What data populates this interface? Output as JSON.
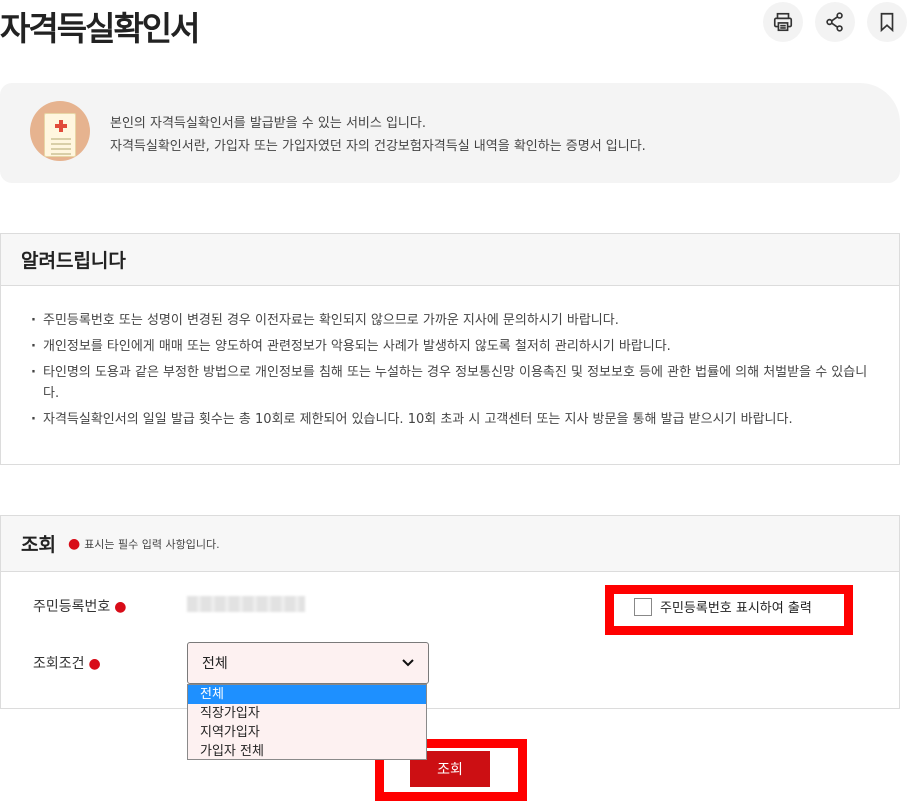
{
  "page": {
    "title": "자격득실확인서"
  },
  "toolbar": {
    "icons": [
      "print-icon",
      "share-icon",
      "bookmark-icon"
    ]
  },
  "intro": {
    "line1": "본인의 자격득실확인서를 발급받을 수 있는 서비스 입니다.",
    "line2": "자격득실확인서란, 가입자 또는 가입자였던 자의 건강보험자격득실 내역을 확인하는 증명서 입니다."
  },
  "notice": {
    "title": "알려드립니다",
    "items": [
      "주민등록번호 또는 성명이 변경된 경우 이전자료는 확인되지 않으므로 가까운 지사에 문의하시기 바랍니다.",
      "개인정보를 타인에게 매매 또는 양도하여 관련정보가 악용되는 사례가 발생하지 않도록 철저히 관리하시기 바랍니다.",
      "타인명의 도용과 같은 부정한 방법으로 개인정보를 침해 또는 누설하는 경우 정보통신망 이용촉진 및 정보보호 등에 관한 법률에 의해 처벌받을 수 있습니다.",
      "자격득실확인서의 일일 발급 횟수는 총 10회로 제한되어 있습니다. 10회 초과 시 고객센터 또는 지사 방문을 통해 발급 받으시기 바랍니다."
    ]
  },
  "query": {
    "title": "조회",
    "required_note": "표시는 필수 입력 사항입니다.",
    "rrn_label": "주민등록번호",
    "show_rrn_label": "주민등록번호 표시하여 출력",
    "condition_label": "조회조건",
    "condition_selected": "전체",
    "condition_options": [
      "전체",
      "직장가입자",
      "지역가입자",
      "가입자 전체"
    ],
    "submit_label": "조회"
  },
  "colors": {
    "accent": "#cc0f13",
    "highlight": "#ff0000",
    "selected_option": "#1e90ff"
  }
}
